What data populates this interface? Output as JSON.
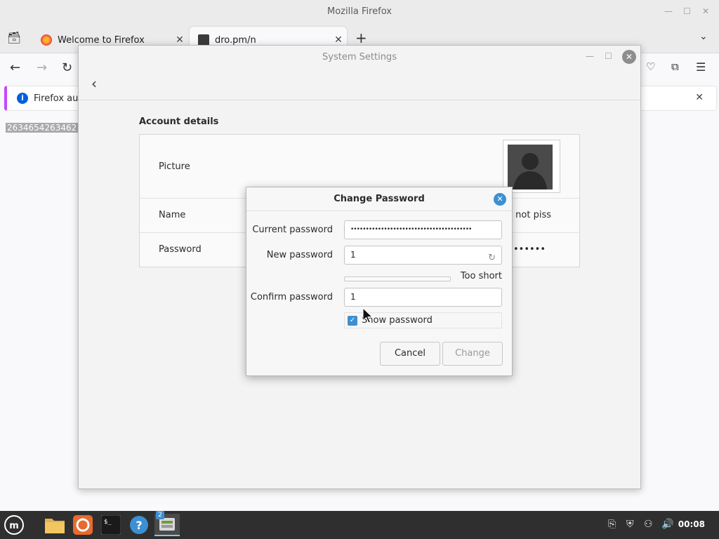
{
  "firefox": {
    "window_title": "Mozilla Firefox",
    "tabs": [
      {
        "label": "Welcome to Firefox",
        "active": false
      },
      {
        "label": "dro.pm/n",
        "active": true
      }
    ],
    "infobar_text": "Firefox aut",
    "page_text": "2634654263462"
  },
  "settings": {
    "title": "System Settings",
    "section_heading": "Account details",
    "rows": {
      "picture_label": "Picture",
      "name_label": "Name",
      "name_value": "e not piss",
      "password_label": "Password",
      "password_value": "••••••"
    }
  },
  "dialog": {
    "title": "Change Password",
    "current_password_label": "Current password",
    "current_password_value": "••••••••••••••••••••••••••••••••••••••••",
    "new_password_label": "New password",
    "new_password_value": "1",
    "strength_label": "Too short",
    "strength_fraction": 0,
    "confirm_password_label": "Confirm password",
    "confirm_password_value": "1",
    "show_password_label": "Show password",
    "show_password_checked": true,
    "cancel_label": "Cancel",
    "change_label": "Change"
  },
  "taskbar": {
    "clock": "00:08",
    "badge": "2"
  },
  "colors": {
    "accent_blue": "#3d8fd1",
    "taskbar_bg": "#2f2f2f",
    "infobar_accent": "#c847ff"
  }
}
